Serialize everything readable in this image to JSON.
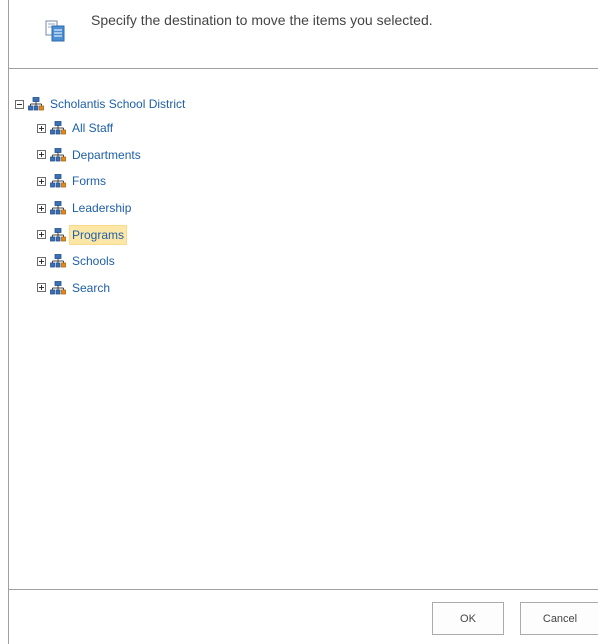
{
  "header": {
    "icon": "move-items-icon",
    "instruction": "Specify the destination to move the items you selected."
  },
  "tree": {
    "root": {
      "label": "Scholantis School District",
      "icon": "site-icon",
      "expanded": true
    },
    "children": [
      {
        "label": "All Staff",
        "icon": "site-icon",
        "expanded": false,
        "selected": false
      },
      {
        "label": "Departments",
        "icon": "site-icon",
        "expanded": false,
        "selected": false
      },
      {
        "label": "Forms",
        "icon": "site-icon",
        "expanded": false,
        "selected": false
      },
      {
        "label": "Leadership",
        "icon": "site-icon",
        "expanded": false,
        "selected": false
      },
      {
        "label": "Programs",
        "icon": "site-icon",
        "expanded": false,
        "selected": true
      },
      {
        "label": "Schools",
        "icon": "site-icon",
        "expanded": false,
        "selected": false
      },
      {
        "label": "Search",
        "icon": "site-icon",
        "expanded": false,
        "selected": false
      }
    ]
  },
  "footer": {
    "ok_label": "OK",
    "cancel_label": "Cancel"
  },
  "colors": {
    "link": "#1e5fa8",
    "selected_bg": "#fde7a6",
    "border": "#a0a0a0"
  }
}
